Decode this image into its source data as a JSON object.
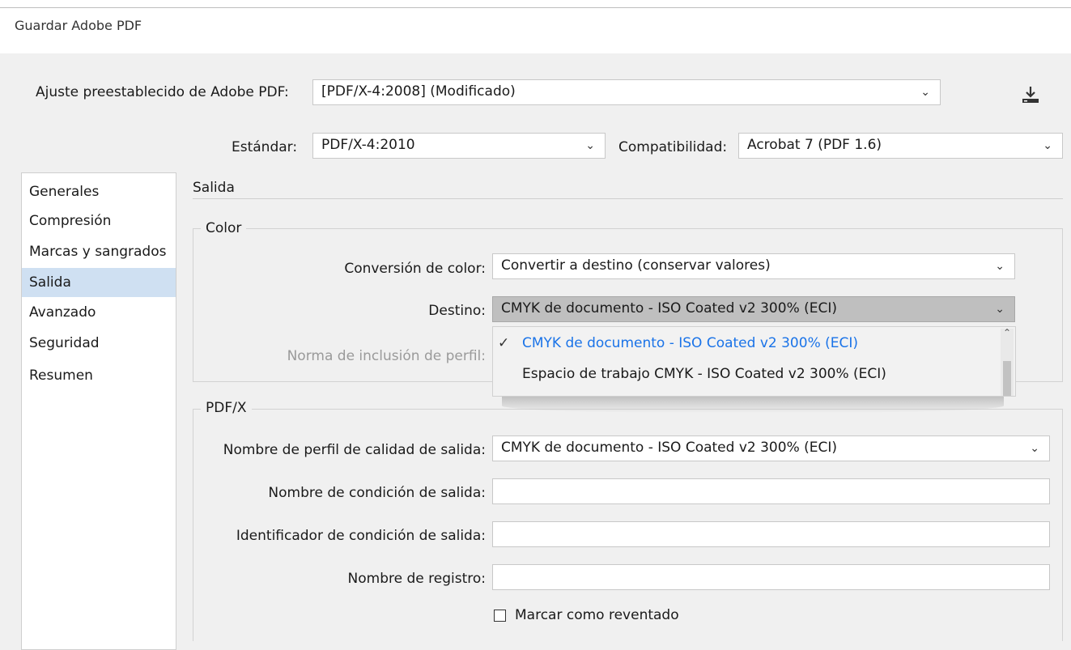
{
  "window": {
    "title": "Guardar Adobe PDF"
  },
  "preset": {
    "label": "Ajuste preestablecido de Adobe PDF:",
    "value": "[PDF/X-4:2008] (Modificado)"
  },
  "standard": {
    "label": "Estándar:",
    "value": "PDF/X-4:2010"
  },
  "compat": {
    "label": "Compatibilidad:",
    "value": "Acrobat 7 (PDF 1.6)"
  },
  "sidebar": {
    "items": [
      {
        "label": "Generales"
      },
      {
        "label": "Compresión"
      },
      {
        "label": "Marcas y sangrados"
      },
      {
        "label": "Salida"
      },
      {
        "label": "Avanzado"
      },
      {
        "label": "Seguridad"
      },
      {
        "label": "Resumen"
      }
    ],
    "selected": "Salida"
  },
  "section_title": "Salida",
  "color_group": {
    "legend": "Color",
    "conversion_label": "Conversión de color:",
    "conversion_value": "Convertir a destino (conservar valores)",
    "destino_label": "Destino:",
    "destino_value": "CMYK de documento - ISO Coated v2 300% (ECI)",
    "profile_label": "Norma de inclusión de perfil:"
  },
  "dropdown": {
    "options": [
      {
        "label": "CMYK de documento - ISO Coated v2 300% (ECI)",
        "checked": true
      },
      {
        "label": "Espacio de trabajo CMYK - ISO Coated v2 300% (ECI)",
        "checked": false
      }
    ],
    "check_glyph": "✓"
  },
  "pdfx_group": {
    "legend": "PDF/X",
    "output_profile_label": "Nombre de perfil de calidad de salida:",
    "output_profile_value": "CMYK de documento - ISO Coated v2 300% (ECI)",
    "condition_name_label": "Nombre de condición de salida:",
    "condition_name_value": "",
    "condition_id_label": "Identificador de condición de salida:",
    "condition_id_value": "",
    "registry_label": "Nombre de registro:",
    "registry_value": "",
    "trapped_label": "Marcar como reventado",
    "trapped_checked": false
  },
  "icons": {
    "save_preset": "download-icon",
    "chevron": "chevron-down-icon"
  },
  "colors": {
    "selection": "#cfe0f2",
    "selected_option_text": "#1a73e8",
    "destino_bg": "#bfbfbf"
  }
}
